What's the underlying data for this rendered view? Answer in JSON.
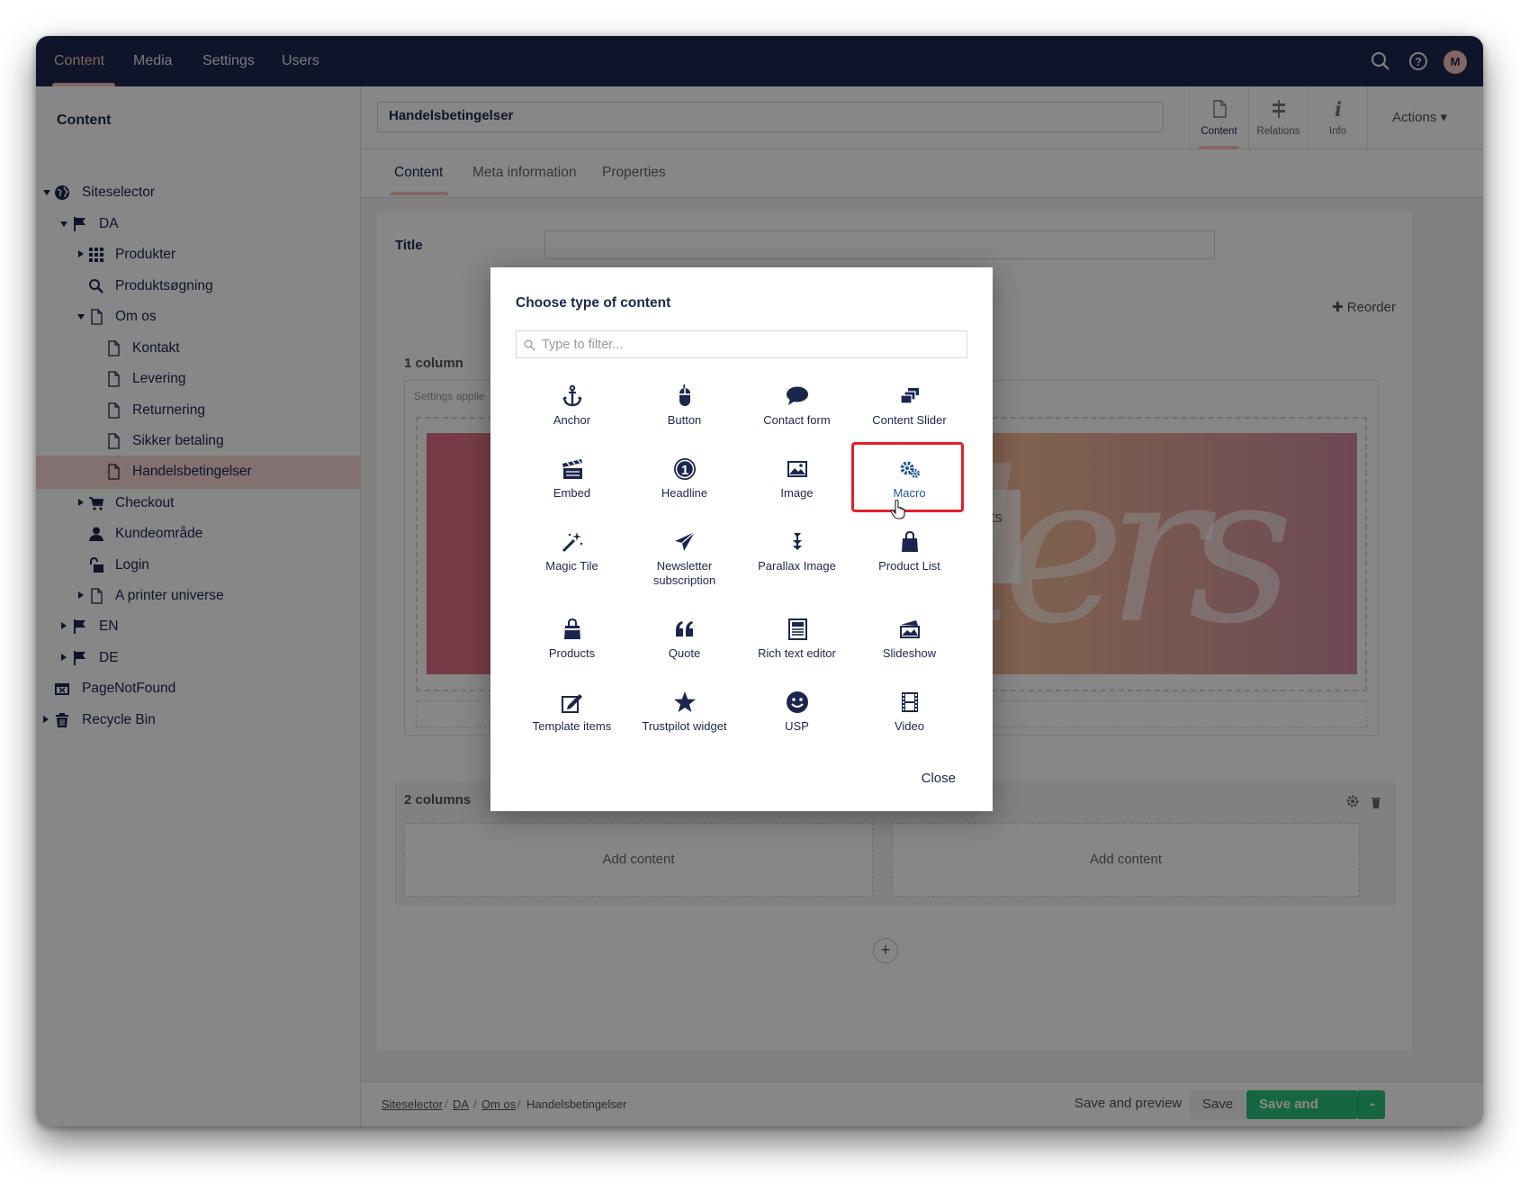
{
  "topnav": {
    "items": [
      "Content",
      "Media",
      "Settings",
      "Users"
    ],
    "active_index": 0,
    "avatar_initial": "M",
    "icons": [
      "search-icon",
      "help-icon"
    ]
  },
  "sidebar": {
    "title": "Content",
    "tree": [
      {
        "label": "Siteselector",
        "icon": "globe-icon"
      },
      {
        "label": "DA",
        "icon": "flag-icon"
      },
      {
        "label": "Produkter",
        "icon": "grid-icon"
      },
      {
        "label": "Produktsøgning",
        "icon": "search-icon"
      },
      {
        "label": "Om os",
        "icon": "document-icon"
      },
      {
        "label": "Kontakt",
        "icon": "document-icon"
      },
      {
        "label": "Levering",
        "icon": "document-icon"
      },
      {
        "label": "Returnering",
        "icon": "document-icon"
      },
      {
        "label": "Sikker betaling",
        "icon": "document-icon"
      },
      {
        "label": "Handelsbetingelser",
        "icon": "document-icon",
        "selected": true
      },
      {
        "label": "Checkout",
        "icon": "cart-icon"
      },
      {
        "label": "Kundeområde",
        "icon": "user-icon"
      },
      {
        "label": "Login",
        "icon": "unlock-icon"
      },
      {
        "label": "A printer universe",
        "icon": "document-icon"
      },
      {
        "label": "EN",
        "icon": "flag-icon"
      },
      {
        "label": "DE",
        "icon": "flag-icon"
      },
      {
        "label": "PageNotFound",
        "icon": "calendar-x-icon"
      },
      {
        "label": "Recycle Bin",
        "icon": "trash-icon"
      }
    ]
  },
  "editor": {
    "node_name": "Handelsbetingelser",
    "app_tabs": [
      {
        "label": "Content",
        "icon": "document-icon"
      },
      {
        "label": "Relations",
        "icon": "relations-icon"
      },
      {
        "label": "Info",
        "icon": "info-icon"
      }
    ],
    "actions_label": "Actions",
    "sub_tabs": [
      "Content",
      "Meta information",
      "Properties"
    ],
    "title_label": "Title",
    "reorder_label": "Reorder",
    "one_column_label": "1 column",
    "settings_applied": "Settings applie",
    "hero_text": "llers",
    "hero_card_text": "cts",
    "two_columns_label": "2 columns",
    "add_content_left": "Add content",
    "add_content_right": "Add content"
  },
  "footer": {
    "breadcrumb": [
      "Siteselector",
      "DA",
      "Om os",
      "Handelsbetingelser"
    ],
    "save_preview": "Save and preview",
    "save": "Save",
    "save_publish": "Save and publish"
  },
  "dialog": {
    "title": "Choose type of content",
    "filter_placeholder": "Type to filter...",
    "close_label": "Close",
    "highlighted": "Macro",
    "highlight_color": "#e3202b",
    "items": [
      {
        "label": "Anchor",
        "icon": "anchor-icon"
      },
      {
        "label": "Button",
        "icon": "mouse-icon"
      },
      {
        "label": "Contact form",
        "icon": "chat-bubble-icon"
      },
      {
        "label": "Content Slider",
        "icon": "stack-icon"
      },
      {
        "label": "Embed",
        "icon": "clapperboard-icon"
      },
      {
        "label": "Headline",
        "icon": "number-one-icon"
      },
      {
        "label": "Image",
        "icon": "picture-icon"
      },
      {
        "label": "Macro",
        "icon": "gears-icon"
      },
      {
        "label": "Magic Tile",
        "icon": "magic-wand-icon"
      },
      {
        "label": "Newsletter subscription",
        "icon": "paper-plane-icon"
      },
      {
        "label": "Parallax Image",
        "icon": "vertical-arrows-icon"
      },
      {
        "label": "Product List",
        "icon": "shopping-bag-icon"
      },
      {
        "label": "Products",
        "icon": "bag-icon"
      },
      {
        "label": "Quote",
        "icon": "quote-icon"
      },
      {
        "label": "Rich text editor",
        "icon": "newspaper-icon"
      },
      {
        "label": "Slideshow",
        "icon": "slideshow-icon"
      },
      {
        "label": "Template items",
        "icon": "edit-icon"
      },
      {
        "label": "Trustpilot widget",
        "icon": "star-icon"
      },
      {
        "label": "USP",
        "icon": "smiley-icon"
      },
      {
        "label": "Video",
        "icon": "film-icon"
      }
    ]
  }
}
